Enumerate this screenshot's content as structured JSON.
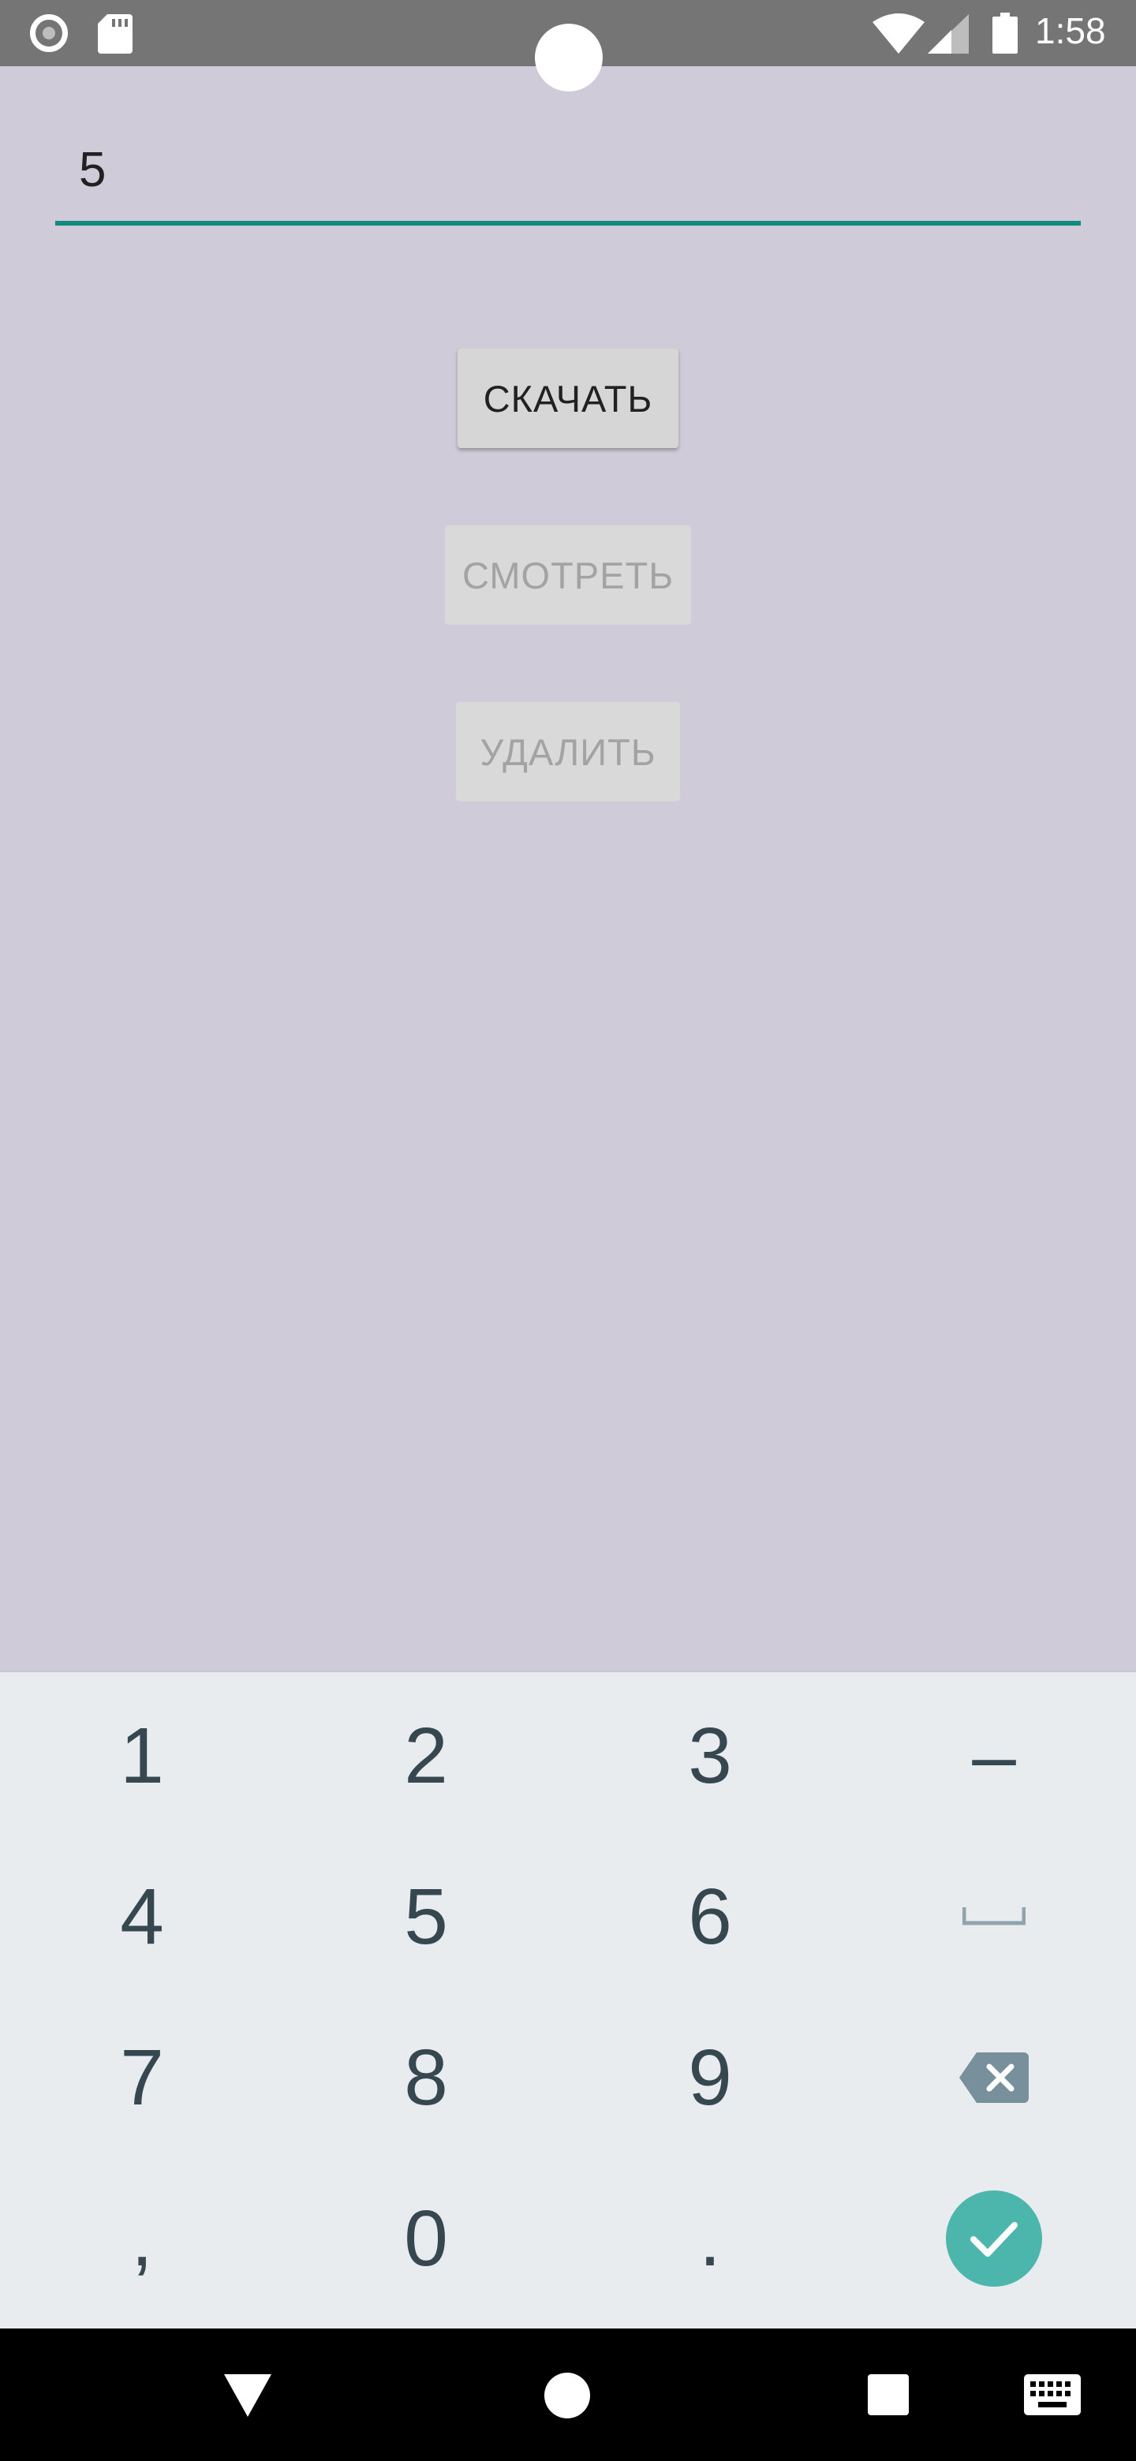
{
  "status_bar": {
    "time": "1:58",
    "icons": [
      "record-icon",
      "sd-card-icon",
      "wifi-icon",
      "cell-signal-icon",
      "battery-icon"
    ]
  },
  "input": {
    "value": "5"
  },
  "buttons": {
    "download_label": "СКАЧАТЬ",
    "view_label": "СМОТРЕТЬ",
    "delete_label": "УДАЛИТЬ"
  },
  "keyboard": {
    "keys": [
      "1",
      "2",
      "3",
      "–",
      "4",
      "5",
      "6",
      "7",
      "8",
      "9",
      ",",
      "0",
      "."
    ],
    "extra_keys": [
      "space-icon",
      "backspace-icon",
      "done-check-icon"
    ]
  },
  "nav_bar": {
    "icons": [
      "back-icon",
      "home-icon",
      "recents-icon",
      "keyboard-icon"
    ]
  },
  "colors": {
    "background": "#d0cbd8",
    "accent": "#128a80",
    "keyboard_bg": "#e8ecef",
    "done_key": "#4db6ac"
  }
}
